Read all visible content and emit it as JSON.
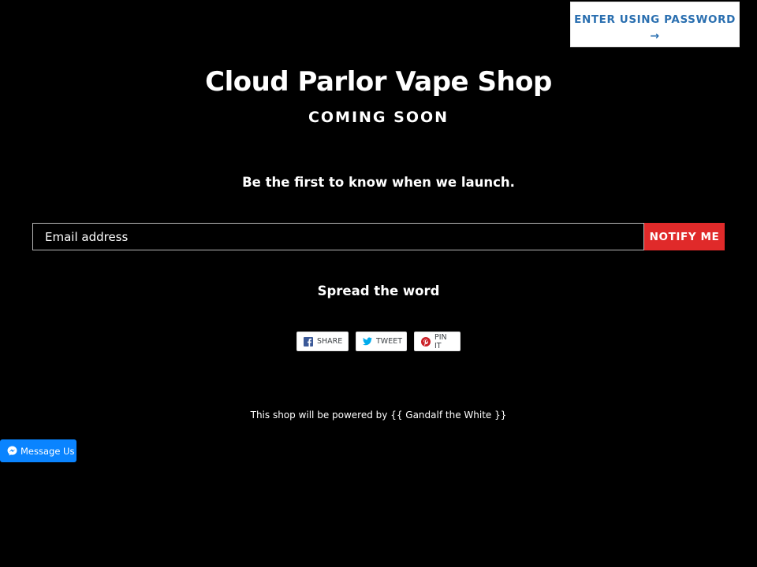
{
  "header": {
    "password_button_label": "ENTER USING PASSWORD",
    "password_button_arrow": "→"
  },
  "hero": {
    "store_name": "Cloud Parlor Vape Shop",
    "status": "COMING SOON",
    "tagline": "Be the first to know when we launch."
  },
  "signup": {
    "email_placeholder": "Email address",
    "submit_label": "NOTIFY ME"
  },
  "social": {
    "heading": "Spread the word",
    "buttons": [
      {
        "label": "SHARE",
        "icon": "facebook-icon"
      },
      {
        "label": "TWEET",
        "icon": "twitter-icon"
      },
      {
        "label": "PIN IT",
        "icon": "pinterest-icon"
      }
    ]
  },
  "footer": {
    "powered_by": "This shop will be powered by {{ Gandalf the White }}"
  },
  "messenger": {
    "label": "Message Us",
    "icon": "messenger-icon"
  },
  "colors": {
    "background": "#000000",
    "notify_button": "#e02a2a",
    "password_text": "#2a6fb0",
    "messenger_button": "#0a84ff",
    "facebook": "#3b5998",
    "twitter": "#00aced",
    "pinterest": "#cb2027"
  }
}
